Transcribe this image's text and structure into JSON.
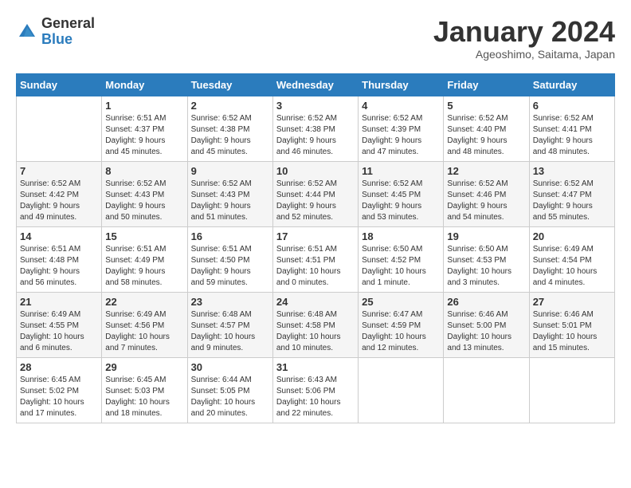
{
  "logo": {
    "general": "General",
    "blue": "Blue"
  },
  "title": "January 2024",
  "subtitle": "Ageoshimo, Saitama, Japan",
  "days_of_week": [
    "Sunday",
    "Monday",
    "Tuesday",
    "Wednesday",
    "Thursday",
    "Friday",
    "Saturday"
  ],
  "weeks": [
    [
      {
        "day": "",
        "info": ""
      },
      {
        "day": "1",
        "info": "Sunrise: 6:51 AM\nSunset: 4:37 PM\nDaylight: 9 hours\nand 45 minutes."
      },
      {
        "day": "2",
        "info": "Sunrise: 6:52 AM\nSunset: 4:38 PM\nDaylight: 9 hours\nand 45 minutes."
      },
      {
        "day": "3",
        "info": "Sunrise: 6:52 AM\nSunset: 4:38 PM\nDaylight: 9 hours\nand 46 minutes."
      },
      {
        "day": "4",
        "info": "Sunrise: 6:52 AM\nSunset: 4:39 PM\nDaylight: 9 hours\nand 47 minutes."
      },
      {
        "day": "5",
        "info": "Sunrise: 6:52 AM\nSunset: 4:40 PM\nDaylight: 9 hours\nand 48 minutes."
      },
      {
        "day": "6",
        "info": "Sunrise: 6:52 AM\nSunset: 4:41 PM\nDaylight: 9 hours\nand 48 minutes."
      }
    ],
    [
      {
        "day": "7",
        "info": "Sunrise: 6:52 AM\nSunset: 4:42 PM\nDaylight: 9 hours\nand 49 minutes."
      },
      {
        "day": "8",
        "info": "Sunrise: 6:52 AM\nSunset: 4:43 PM\nDaylight: 9 hours\nand 50 minutes."
      },
      {
        "day": "9",
        "info": "Sunrise: 6:52 AM\nSunset: 4:43 PM\nDaylight: 9 hours\nand 51 minutes."
      },
      {
        "day": "10",
        "info": "Sunrise: 6:52 AM\nSunset: 4:44 PM\nDaylight: 9 hours\nand 52 minutes."
      },
      {
        "day": "11",
        "info": "Sunrise: 6:52 AM\nSunset: 4:45 PM\nDaylight: 9 hours\nand 53 minutes."
      },
      {
        "day": "12",
        "info": "Sunrise: 6:52 AM\nSunset: 4:46 PM\nDaylight: 9 hours\nand 54 minutes."
      },
      {
        "day": "13",
        "info": "Sunrise: 6:52 AM\nSunset: 4:47 PM\nDaylight: 9 hours\nand 55 minutes."
      }
    ],
    [
      {
        "day": "14",
        "info": "Sunrise: 6:51 AM\nSunset: 4:48 PM\nDaylight: 9 hours\nand 56 minutes."
      },
      {
        "day": "15",
        "info": "Sunrise: 6:51 AM\nSunset: 4:49 PM\nDaylight: 9 hours\nand 58 minutes."
      },
      {
        "day": "16",
        "info": "Sunrise: 6:51 AM\nSunset: 4:50 PM\nDaylight: 9 hours\nand 59 minutes."
      },
      {
        "day": "17",
        "info": "Sunrise: 6:51 AM\nSunset: 4:51 PM\nDaylight: 10 hours\nand 0 minutes."
      },
      {
        "day": "18",
        "info": "Sunrise: 6:50 AM\nSunset: 4:52 PM\nDaylight: 10 hours\nand 1 minute."
      },
      {
        "day": "19",
        "info": "Sunrise: 6:50 AM\nSunset: 4:53 PM\nDaylight: 10 hours\nand 3 minutes."
      },
      {
        "day": "20",
        "info": "Sunrise: 6:49 AM\nSunset: 4:54 PM\nDaylight: 10 hours\nand 4 minutes."
      }
    ],
    [
      {
        "day": "21",
        "info": "Sunrise: 6:49 AM\nSunset: 4:55 PM\nDaylight: 10 hours\nand 6 minutes."
      },
      {
        "day": "22",
        "info": "Sunrise: 6:49 AM\nSunset: 4:56 PM\nDaylight: 10 hours\nand 7 minutes."
      },
      {
        "day": "23",
        "info": "Sunrise: 6:48 AM\nSunset: 4:57 PM\nDaylight: 10 hours\nand 9 minutes."
      },
      {
        "day": "24",
        "info": "Sunrise: 6:48 AM\nSunset: 4:58 PM\nDaylight: 10 hours\nand 10 minutes."
      },
      {
        "day": "25",
        "info": "Sunrise: 6:47 AM\nSunset: 4:59 PM\nDaylight: 10 hours\nand 12 minutes."
      },
      {
        "day": "26",
        "info": "Sunrise: 6:46 AM\nSunset: 5:00 PM\nDaylight: 10 hours\nand 13 minutes."
      },
      {
        "day": "27",
        "info": "Sunrise: 6:46 AM\nSunset: 5:01 PM\nDaylight: 10 hours\nand 15 minutes."
      }
    ],
    [
      {
        "day": "28",
        "info": "Sunrise: 6:45 AM\nSunset: 5:02 PM\nDaylight: 10 hours\nand 17 minutes."
      },
      {
        "day": "29",
        "info": "Sunrise: 6:45 AM\nSunset: 5:03 PM\nDaylight: 10 hours\nand 18 minutes."
      },
      {
        "day": "30",
        "info": "Sunrise: 6:44 AM\nSunset: 5:05 PM\nDaylight: 10 hours\nand 20 minutes."
      },
      {
        "day": "31",
        "info": "Sunrise: 6:43 AM\nSunset: 5:06 PM\nDaylight: 10 hours\nand 22 minutes."
      },
      {
        "day": "",
        "info": ""
      },
      {
        "day": "",
        "info": ""
      },
      {
        "day": "",
        "info": ""
      }
    ]
  ]
}
